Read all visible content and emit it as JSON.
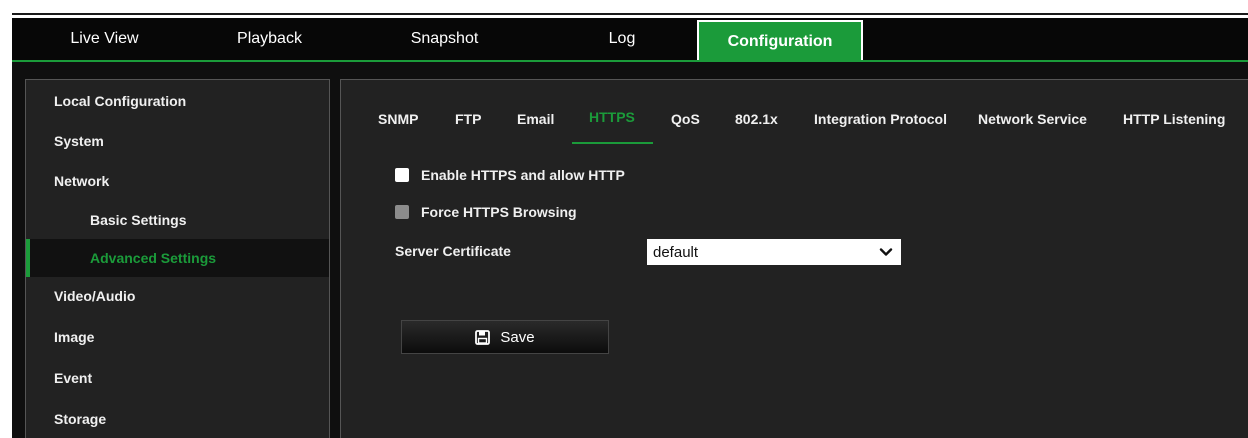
{
  "nav": {
    "tabs": [
      {
        "label": "Live View",
        "active": false
      },
      {
        "label": "Playback",
        "active": false
      },
      {
        "label": "Snapshot",
        "active": false
      },
      {
        "label": "Log",
        "active": false
      },
      {
        "label": "Configuration",
        "active": true
      }
    ]
  },
  "sidebar": {
    "items": [
      {
        "label": "Local Configuration"
      },
      {
        "label": "System"
      },
      {
        "label": "Network"
      },
      {
        "label": "Basic Settings"
      },
      {
        "label": "Advanced Settings"
      },
      {
        "label": "Video/Audio"
      },
      {
        "label": "Image"
      },
      {
        "label": "Event"
      },
      {
        "label": "Storage"
      }
    ]
  },
  "subtabs": [
    {
      "label": "SNMP"
    },
    {
      "label": "FTP"
    },
    {
      "label": "Email"
    },
    {
      "label": "HTTPS"
    },
    {
      "label": "QoS"
    },
    {
      "label": "802.1x"
    },
    {
      "label": "Integration Protocol"
    },
    {
      "label": "Network Service"
    },
    {
      "label": "HTTP Listening"
    }
  ],
  "form": {
    "enable_https_label": "Enable HTTPS and allow HTTP",
    "force_https_label": "Force HTTPS Browsing",
    "server_certificate_label": "Server Certificate",
    "server_certificate_value": "default",
    "save_label": "Save"
  },
  "colors": {
    "accent": "#1b9b3a",
    "panel": "#222222",
    "background": "#0f0f0f"
  },
  "icons": {
    "save": "floppy-disk-icon",
    "dropdown": "chevron-down-icon"
  }
}
